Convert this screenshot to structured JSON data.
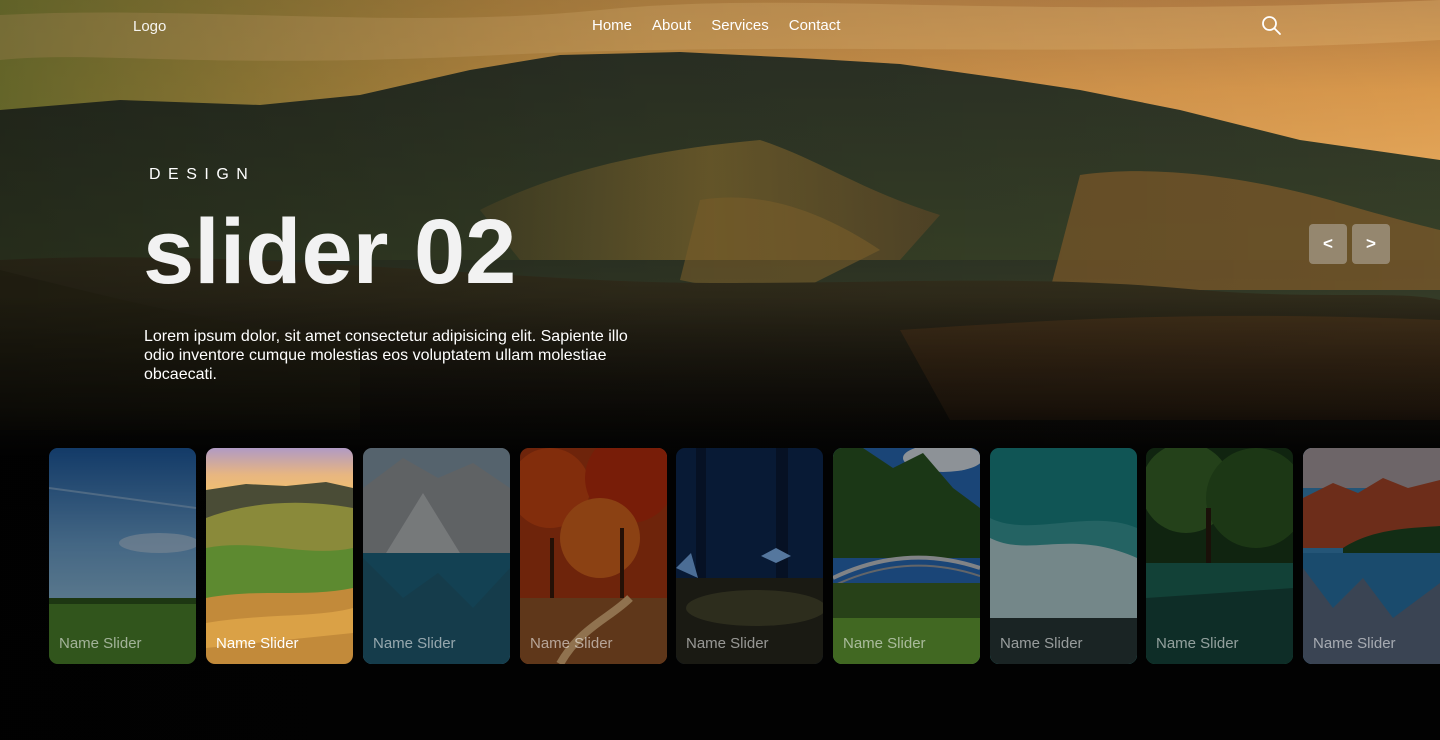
{
  "nav": {
    "logo": "Logo",
    "menu": [
      "Home",
      "About",
      "Services",
      "Contact"
    ]
  },
  "icons": {
    "search": "search-icon"
  },
  "hero": {
    "kicker": "DESIGN",
    "title": "slider 02",
    "description": "Lorem ipsum dolor, sit amet consectetur adipisicing elit. Sapiente illo odio inventore cumque molestias eos voluptatem ullam molestiae obcaecati.",
    "prev": "<",
    "next": ">"
  },
  "thumbnails": [
    {
      "caption": "Name Slider",
      "active": false
    },
    {
      "caption": "Name Slider",
      "active": true
    },
    {
      "caption": "Name Slider",
      "active": false
    },
    {
      "caption": "Name Slider",
      "active": false
    },
    {
      "caption": "Name Slider",
      "active": false
    },
    {
      "caption": "Name Slider",
      "active": false
    },
    {
      "caption": "Name Slider",
      "active": false
    },
    {
      "caption": "Name Slider",
      "active": false
    },
    {
      "caption": "Name Slider",
      "active": false
    }
  ]
}
